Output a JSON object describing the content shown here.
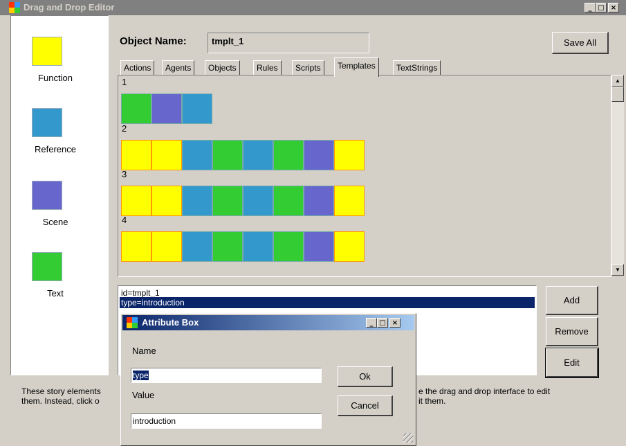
{
  "window": {
    "title": "Drag and Drop Editor",
    "controls": {
      "minimize": "_",
      "maximize": "□",
      "close": "×"
    }
  },
  "palette": [
    {
      "label": "Function",
      "color": "#ffff00"
    },
    {
      "label": "Reference",
      "color": "#3399cc"
    },
    {
      "label": "Scene",
      "color": "#6666cc"
    },
    {
      "label": "Text",
      "color": "#33cc33"
    }
  ],
  "header": {
    "object_name_label": "Object Name:",
    "object_name_value": "tmplt_1",
    "save_all": "Save All"
  },
  "tabs": [
    {
      "label": "Actions",
      "active": false
    },
    {
      "label": "Agents",
      "active": false
    },
    {
      "label": "Objects",
      "active": false
    },
    {
      "label": "Rules",
      "active": false
    },
    {
      "label": "Scripts",
      "active": false
    },
    {
      "label": "Templates",
      "active": true
    },
    {
      "label": "TextStrings",
      "active": false
    }
  ],
  "colors": {
    "Function": "#ffff00",
    "Reference": "#3399cc",
    "Scene": "#6666cc",
    "Text": "#33cc33"
  },
  "templates": [
    {
      "label": "1",
      "blocks": [
        "Text",
        "Scene",
        "Reference"
      ]
    },
    {
      "label": "2",
      "blocks": [
        "Function",
        "Function",
        "Reference",
        "Text",
        "Reference",
        "Text",
        "Scene",
        "Function"
      ]
    },
    {
      "label": "3",
      "blocks": [
        "Function",
        "Function",
        "Reference",
        "Text",
        "Reference",
        "Text",
        "Scene",
        "Function"
      ]
    },
    {
      "label": "4",
      "blocks": [
        "Function",
        "Function",
        "Reference",
        "Text",
        "Reference",
        "Text",
        "Scene",
        "Function"
      ]
    }
  ],
  "attributes": [
    {
      "text": "id=tmplt_1",
      "selected": false
    },
    {
      "text": "type=introduction",
      "selected": true
    }
  ],
  "buttons": {
    "add": "Add",
    "remove": "Remove",
    "edit": "Edit"
  },
  "info": {
    "left_line1": "These story elements",
    "left_line2": "them. Instead, click o",
    "right_line1": "e the drag and drop interface to edit",
    "right_line2": "it them."
  },
  "dialog": {
    "title": "Attribute Box",
    "name_label": "Name",
    "name_value": "type",
    "value_label": "Value",
    "value_value": "introduction",
    "ok": "Ok",
    "cancel": "Cancel"
  }
}
